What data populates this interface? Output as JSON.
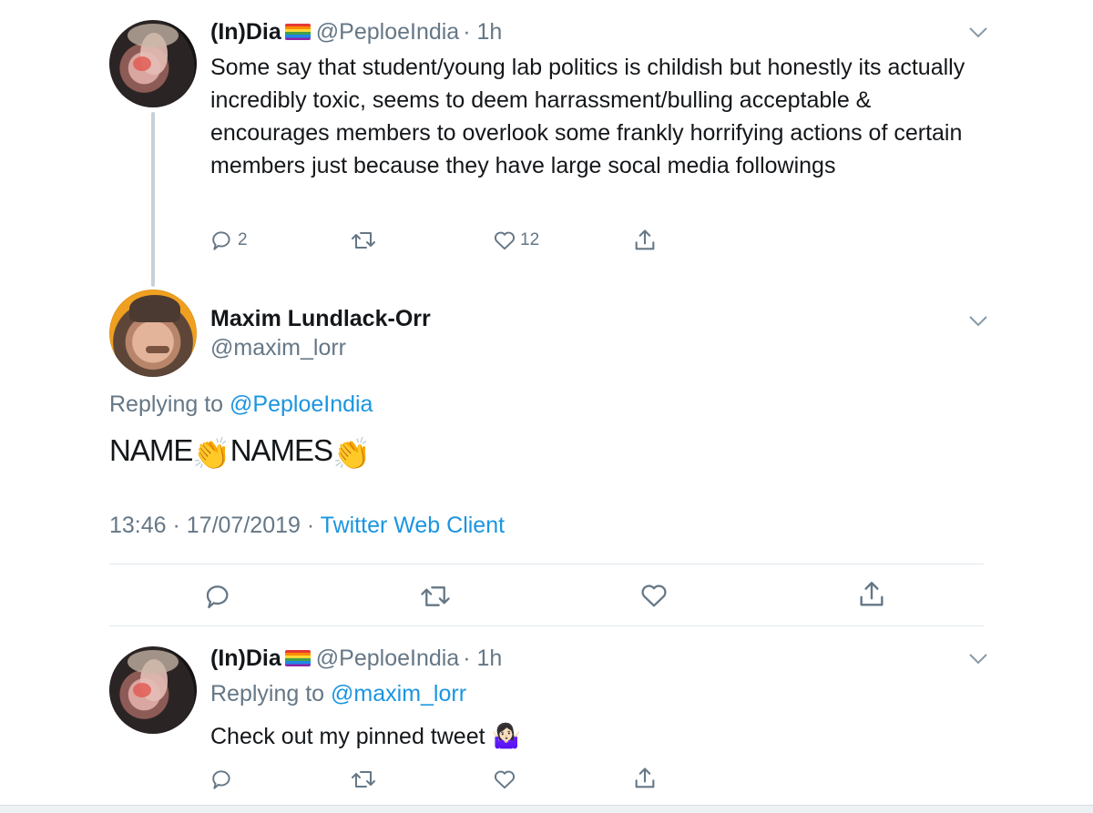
{
  "tweet1": {
    "name": "(In)Dia",
    "flag": "🏳️‍🌈",
    "handle": "@PeploeIndia",
    "time": "· 1h",
    "text": "Some say that student/young lab politics is childish but honestly its actually incredibly toxic, seems to deem harrassment/bulling acceptable & encourages members to overlook some frankly horrifying actions of certain members just because they have large socal media followings",
    "reply_count": "2",
    "like_count": "12"
  },
  "tweet2": {
    "name": "Maxim Lundlack-Orr",
    "handle": "@maxim_lorr",
    "replying_prefix": "Replying to",
    "replying_handle": "@PeploeIndia",
    "text_part1": "NAME",
    "text_part2": "NAMES",
    "emoji": "👏",
    "timestamp": "13:46 · 17/07/2019 ·",
    "client": "Twitter Web Client"
  },
  "tweet3": {
    "name": "(In)Dia",
    "flag": "🏳️‍🌈",
    "handle": "@PeploeIndia",
    "time": "· 1h",
    "replying_prefix": "Replying to",
    "replying_handle": "@maxim_lorr",
    "text": "Check out my pinned tweet",
    "emoji": "🤷🏻‍♀️"
  },
  "colors": {
    "accent": "#1b95e0",
    "secondary": "#657786",
    "divider": "#e1e8ed"
  },
  "icons": [
    "reply-icon",
    "retweet-icon",
    "like-icon",
    "share-icon",
    "chevron-down-icon"
  ]
}
